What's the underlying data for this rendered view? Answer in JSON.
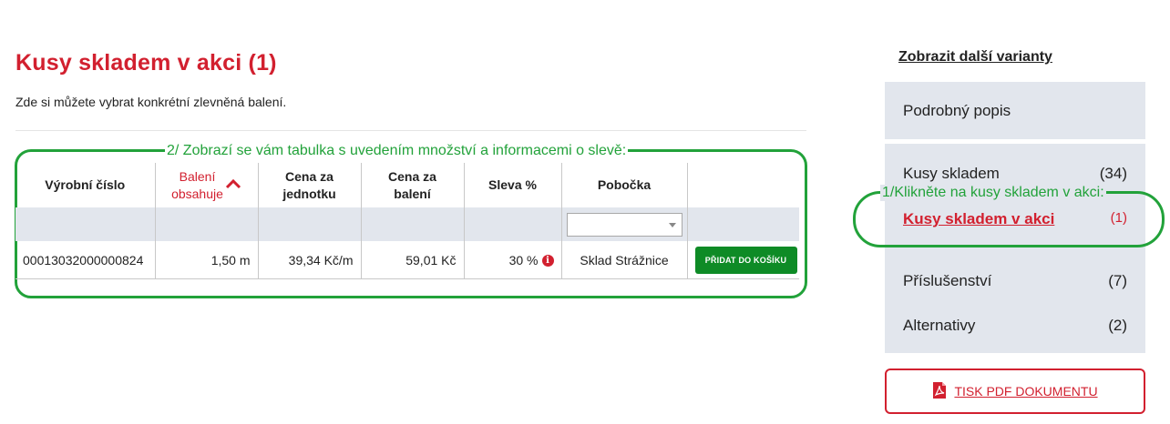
{
  "page": {
    "title": "Kusy skladem v akci (1)",
    "subtitle": "Zde si můžete vybrat konkrétní zlevněná balení."
  },
  "annotations": {
    "table_note": "2/ Zobrazí se vám tabulka s uvedením množství a informacemi o slevě:",
    "sidebar_note": "1/Klikněte na kusy skladem v akci:",
    "color": "#22a23a"
  },
  "table": {
    "headers": {
      "serial": "Výrobní číslo",
      "package_line1": "Balení",
      "package_line2": "obsahuje",
      "unit_price_line1": "Cena za",
      "unit_price_line2": "jednotku",
      "pack_price_line1": "Cena za",
      "pack_price_line2": "balení",
      "discount": "Sleva %",
      "branch": "Pobočka"
    },
    "branch_filter_value": "",
    "rows": [
      {
        "serial": "00013032000000824",
        "package": "1,50 m",
        "unit_price": "39,34 Kč/m",
        "pack_price": "59,01 Kč",
        "discount": "30 %",
        "branch": "Sklad Strážnice",
        "action": "PŘIDAT DO KOŠÍKU"
      }
    ]
  },
  "sidebar": {
    "variants_link": "Zobrazit další varianty",
    "description": "Podrobný popis",
    "items": [
      {
        "label": "Kusy skladem",
        "count": "(34)"
      },
      {
        "label": "Kusy skladem v akci",
        "count": "(1)"
      },
      {
        "label": "Příslušenství",
        "count": "(7)"
      },
      {
        "label": "Alternativy",
        "count": "(2)"
      }
    ],
    "pdf_button": "TISK PDF DOKUMENTU"
  },
  "colors": {
    "accent_red": "#d2202f",
    "button_green": "#0e8b26",
    "panel_bg": "#e2e6ed"
  }
}
